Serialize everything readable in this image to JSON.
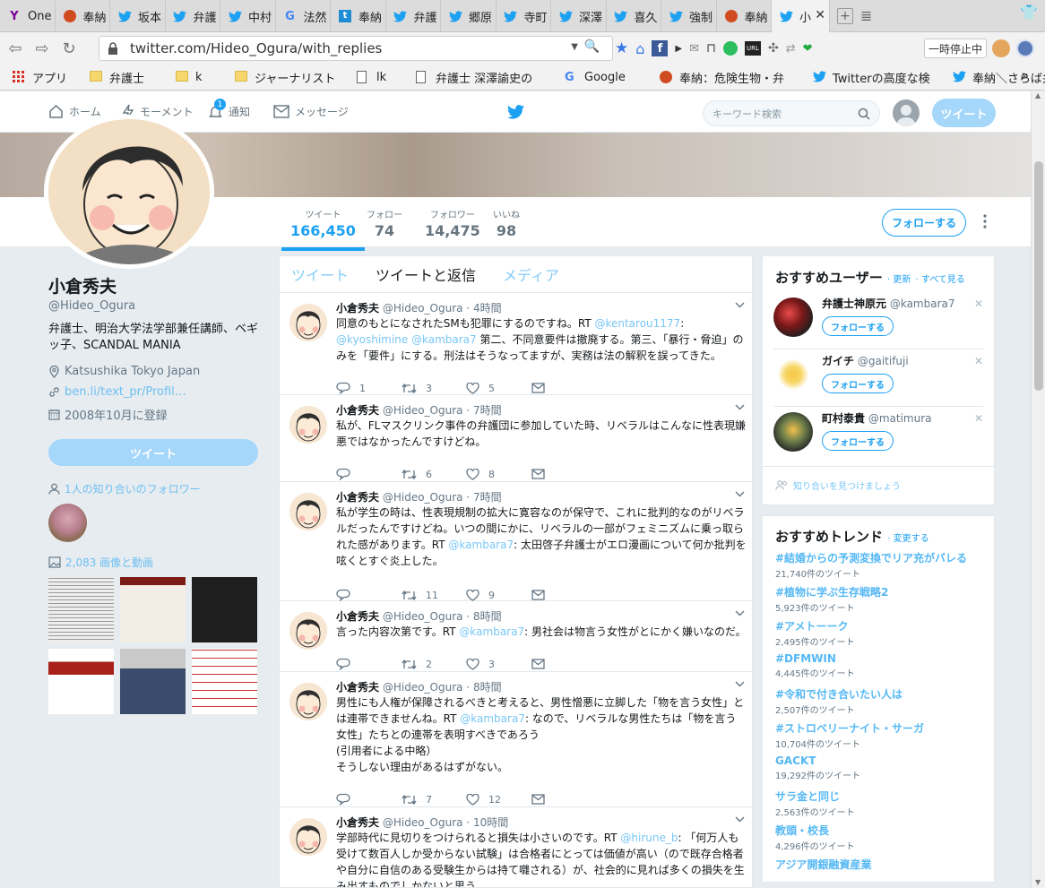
{
  "tabs": [
    {
      "label": "One",
      "icon": "yahoo-icon",
      "color": "#7b0099"
    },
    {
      "label": "奉納",
      "icon": "blog-icon",
      "color": "#d14b20"
    },
    {
      "label": "坂本",
      "icon": "twitter-icon",
      "color": "#1da1f2"
    },
    {
      "label": "弁護",
      "icon": "twitter-icon",
      "color": "#1da1f2"
    },
    {
      "label": "中村",
      "icon": "twitter-icon",
      "color": "#1da1f2"
    },
    {
      "label": "法然",
      "icon": "google-icon",
      "color": "#4285f4"
    },
    {
      "label": "奉納",
      "icon": "tumblr-icon",
      "color": "#35465c"
    },
    {
      "label": "弁護",
      "icon": "twitter-icon",
      "color": "#1da1f2"
    },
    {
      "label": "郷原",
      "icon": "twitter-icon",
      "color": "#1da1f2"
    },
    {
      "label": "寺町",
      "icon": "twitter-icon",
      "color": "#1da1f2"
    },
    {
      "label": "深澤",
      "icon": "twitter-icon",
      "color": "#1da1f2"
    },
    {
      "label": "喜久",
      "icon": "twitter-icon",
      "color": "#1da1f2"
    },
    {
      "label": "強制",
      "icon": "twitter-icon",
      "color": "#1da1f2"
    },
    {
      "label": "奉納",
      "icon": "blog-icon",
      "color": "#d14b20"
    },
    {
      "label": "小",
      "icon": "twitter-icon",
      "color": "#1da1f2",
      "active": true
    }
  ],
  "browser": {
    "url": "twitter.com/Hideo_Ogura/with_replies",
    "pause_label": "一時停止中"
  },
  "bookmarks": [
    {
      "label": "アプリ",
      "icon": "apps-icon"
    },
    {
      "label": "弁護士",
      "icon": "folder-icon"
    },
    {
      "label": "k",
      "icon": "folder-icon"
    },
    {
      "label": "ジャーナリスト",
      "icon": "folder-icon"
    },
    {
      "label": "lk",
      "icon": "page-icon"
    },
    {
      "label": "弁護士 深澤諭史の",
      "icon": "page-icon"
    },
    {
      "label": "Google",
      "icon": "google-icon"
    },
    {
      "label": "奉納：危険生物・弁",
      "icon": "blog-icon"
    },
    {
      "label": "Twitterの高度な検",
      "icon": "twitter-icon"
    },
    {
      "label": "奉納＼さらば弁護士",
      "icon": "twitter-icon"
    }
  ],
  "nav": {
    "home": "ホーム",
    "moments": "モーメント",
    "notifications": "通知",
    "notif_badge": "1",
    "messages": "メッセージ",
    "search_placeholder": "キーワード検索",
    "tweet": "ツイート"
  },
  "stats": [
    {
      "label": "ツイート",
      "value": "166,450"
    },
    {
      "label": "フォロー",
      "value": "74"
    },
    {
      "label": "フォロワー",
      "value": "14,475"
    },
    {
      "label": "いいね",
      "value": "98"
    }
  ],
  "follow_label": "フォローする",
  "profile": {
    "name": "小倉秀夫",
    "handle": "@Hideo_Ogura",
    "bio": "弁護士、明治大学法学部兼任講師、ベギッ子、SCANDAL MANIA",
    "location": "Katsushika Tokyo Japan",
    "url": "ben.li/text_pr/Profil…",
    "joined": "2008年10月に登録",
    "tweet_btn": "ツイート",
    "followers_you_know": "1人の知り合いのフォロワー",
    "media_link": "2,083 画像と動画"
  },
  "timeline_tabs": [
    "ツイート",
    "ツイートと返信",
    "メディア"
  ],
  "tweets": [
    {
      "name": "小倉秀夫",
      "handle": "@Hideo_Ogura",
      "time": "4時間",
      "parts": [
        [
          "t",
          "同意のもとになされたSMも犯罪にするのですね。RT "
        ],
        [
          "m",
          "@kentarou1177"
        ],
        [
          "t",
          ": "
        ],
        [
          "m",
          "@kyoshimine"
        ],
        [
          "t",
          " "
        ],
        [
          "m",
          "@kambara7"
        ],
        [
          "t",
          " 第二、不同意要件は撤廃する。第三、「暴行・脅迫」のみを「要件」にする。刑法はそうなってますが、実務は法の解釈を誤ってきた。"
        ]
      ],
      "reply": "1",
      "rt": "3",
      "like": "5"
    },
    {
      "name": "小倉秀夫",
      "handle": "@Hideo_Ogura",
      "time": "7時間",
      "parts": [
        [
          "t",
          "私が、FLマスクリンク事件の弁護団に参加していた時、リベラルはこんなに性表現嫌悪ではなかったんですけどね。"
        ]
      ],
      "reply": "",
      "rt": "6",
      "like": "8"
    },
    {
      "name": "小倉秀夫",
      "handle": "@Hideo_Ogura",
      "time": "7時間",
      "parts": [
        [
          "t",
          "私が学生の時は、性表現規制の拡大に寛容なのが保守で、これに批判的なのがリベラルだったんですけどね。いつの間にかに、リベラルの一部がフェミニズムに乗っ取られた感があります。RT "
        ],
        [
          "m",
          "@kambara7"
        ],
        [
          "t",
          ": 太田啓子弁護士がエロ漫画について何か批判を呟くとすぐ炎上した。"
        ]
      ],
      "reply": "",
      "rt": "11",
      "like": "9"
    },
    {
      "name": "小倉秀夫",
      "handle": "@Hideo_Ogura",
      "time": "8時間",
      "parts": [
        [
          "t",
          "言った内容次第です。RT "
        ],
        [
          "m",
          "@kambara7"
        ],
        [
          "t",
          ": 男社会は物言う女性がとにかく嫌いなのだ。"
        ]
      ],
      "reply": "",
      "rt": "2",
      "like": "3"
    },
    {
      "name": "小倉秀夫",
      "handle": "@Hideo_Ogura",
      "time": "8時間",
      "parts": [
        [
          "t",
          "男性にも人権が保障されるべきと考えると、男性憎悪に立脚した「物を言う女性」とは連帯できませんね。RT "
        ],
        [
          "m",
          "@kambara7"
        ],
        [
          "t",
          ": なので、リベラルな男性たちは「物を言う女性」たちとの連帯を表明すべきであろう"
        ],
        [
          "br",
          ""
        ],
        [
          "t",
          "(引用者による中略）"
        ],
        [
          "br",
          ""
        ],
        [
          "t",
          "そうしない理由があるはずがない。"
        ]
      ],
      "reply": "",
      "rt": "7",
      "like": "12"
    },
    {
      "name": "小倉秀夫",
      "handle": "@Hideo_Ogura",
      "time": "10時間",
      "parts": [
        [
          "t",
          "学部時代に見切りをつけられると損失は小さいのです。RT "
        ],
        [
          "m",
          "@hirune_b"
        ],
        [
          "t",
          ": 「何万人も受けて数百人しか受からない試験」は合格者にとっては価値が高い（ので既存合格者や自分に自信のある受験生からは持て囃される）が、社会的に見れば多くの損失を生み出すものでしかないと思う。"
        ]
      ],
      "reply": "",
      "rt": "",
      "like": ""
    }
  ],
  "who_to_follow": {
    "title": "おすすめユーザー",
    "refresh": "· 更新",
    "view_all": "· すべて見る",
    "users": [
      {
        "name": "弁護士神原元",
        "handle": "@kambara7",
        "button": "フォローする"
      },
      {
        "name": "ガイチ",
        "handle": "@gaitifuji",
        "button": "フォローする"
      },
      {
        "name": "町村泰貴",
        "handle": "@matimura",
        "button": "フォローする"
      }
    ],
    "find_friends": "知り合いを見つけましょう"
  },
  "trends": {
    "title": "おすすめトレンド",
    "change": "· 変更する",
    "items": [
      {
        "name": "#結婚からの予測変換でリア充がバレる",
        "count": "21,740件のツイート"
      },
      {
        "name": "#植物に学ぶ生存戦略2",
        "count": "5,923件のツイート"
      },
      {
        "name": "#アメトーーク",
        "count": "2,495件のツイート"
      },
      {
        "name": "#DFMWIN",
        "count": "4,445件のツイート"
      },
      {
        "name": "#令和で付き合いたい人は",
        "count": "2,507件のツイート"
      },
      {
        "name": "#ストロベリーナイト・サーガ",
        "count": "10,704件のツイート"
      },
      {
        "name": "GACKT",
        "count": "19,292件のツイート"
      },
      {
        "name": "サラ金と同じ",
        "count": "2,563件のツイート"
      },
      {
        "name": "教頭・校長",
        "count": "4,296件のツイート"
      },
      {
        "name": "アジア開銀融資産業",
        "count": ""
      }
    ]
  },
  "colors": {
    "accent": "#1da1f2",
    "accent_light": "#a5d7fb",
    "background": "#e6ecf0"
  }
}
